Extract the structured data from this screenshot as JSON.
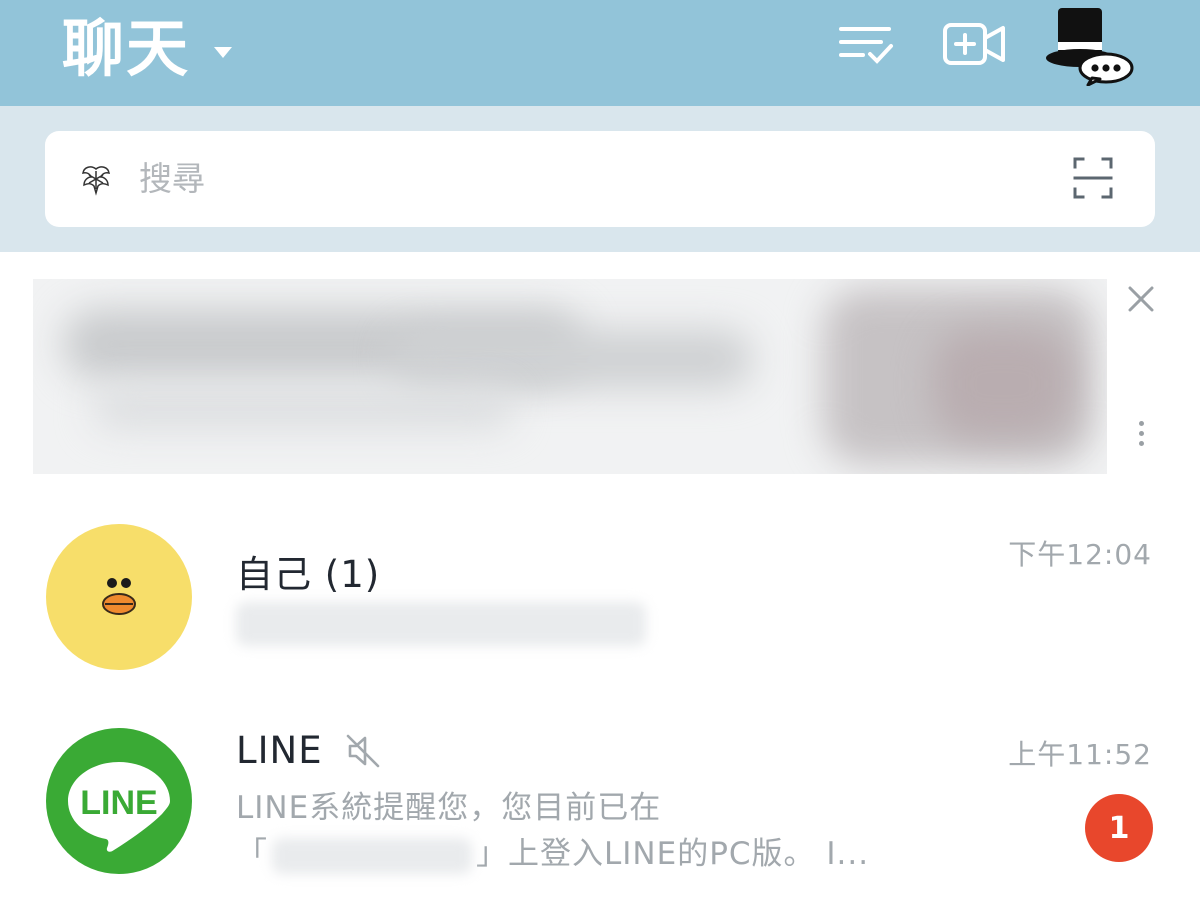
{
  "header": {
    "title": "聊天",
    "icons": {
      "dropdown": "chevron-down-icon",
      "edit_list": "edit-list-icon",
      "new_call": "video-call-add-icon",
      "profile": "top-hat-avatar-icon"
    }
  },
  "search": {
    "placeholder": "搜尋",
    "icon": "search-icon",
    "scan_icon": "qr-scan-icon"
  },
  "ad": {
    "close_icon": "close-icon",
    "more_icon": "more-vertical-icon"
  },
  "chats": [
    {
      "name": "自己 (1)",
      "time": "下午12:04",
      "avatar": "sally-duck-avatar",
      "preview_blurred": true
    },
    {
      "name": "LINE",
      "muted": true,
      "muted_icon": "mute-icon",
      "time": "上午11:52",
      "avatar": "line-logo-avatar",
      "avatar_text": "LINE",
      "preview_line1": "LINE系統提醒您，您目前已在",
      "preview_open": "「",
      "preview_close": "」上登入LINE的PC版。 I...",
      "unread": "1"
    }
  ],
  "colors": {
    "header_bg": "#92c4d9",
    "search_band_bg": "#d9e6ed",
    "badge_red": "#e8472c",
    "line_green": "#3aaa35",
    "sally_yellow": "#f7de6a"
  }
}
